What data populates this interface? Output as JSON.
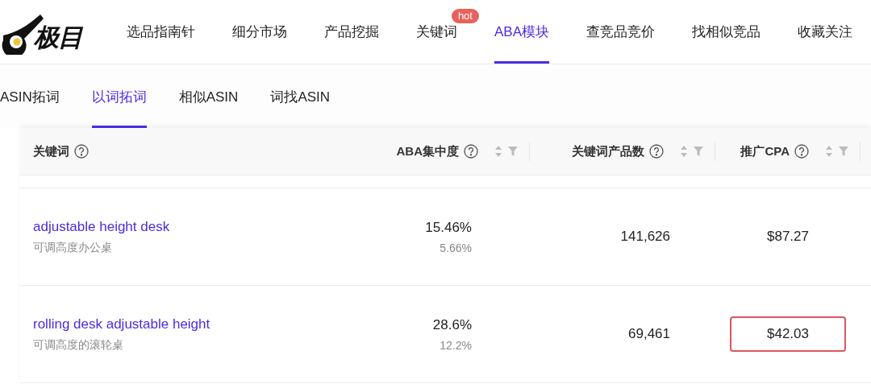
{
  "logo": {
    "text": "极目"
  },
  "nav": [
    {
      "label": "选品指南针",
      "selected": false
    },
    {
      "label": "细分市场",
      "selected": false
    },
    {
      "label": "产品挖掘",
      "selected": false
    },
    {
      "label": "关键词",
      "selected": false,
      "badge": "hot"
    },
    {
      "label": "ABA模块",
      "selected": true
    },
    {
      "label": "查竞品竞价",
      "selected": false
    },
    {
      "label": "找相似竞品",
      "selected": false
    },
    {
      "label": "收藏关注",
      "selected": false
    }
  ],
  "subtabs": [
    {
      "label": "ASIN拓词",
      "selected": false
    },
    {
      "label": "以词拓词",
      "selected": true
    },
    {
      "label": "相似ASIN",
      "selected": false
    },
    {
      "label": "词找ASIN",
      "selected": false
    }
  ],
  "table": {
    "columns": [
      {
        "label": "关键词",
        "sortable": false
      },
      {
        "label": "ABA集中度",
        "sortable": true
      },
      {
        "label": "关键词产品数",
        "sortable": true
      },
      {
        "label": "推广CPA",
        "sortable": true
      }
    ],
    "rows": [
      {
        "keyword": "adjustable height desk",
        "translation": "可调高度办公桌",
        "aba": "15.46%",
        "aba_sub": "5.66%",
        "products": "141,626",
        "cpa": "$87.27",
        "highlighted": false
      },
      {
        "keyword": "rolling desk adjustable height",
        "translation": "可调高度的滚轮桌",
        "aba": "28.6%",
        "aba_sub": "12.2%",
        "products": "69,461",
        "cpa": "$42.03",
        "highlighted": true
      }
    ]
  }
}
